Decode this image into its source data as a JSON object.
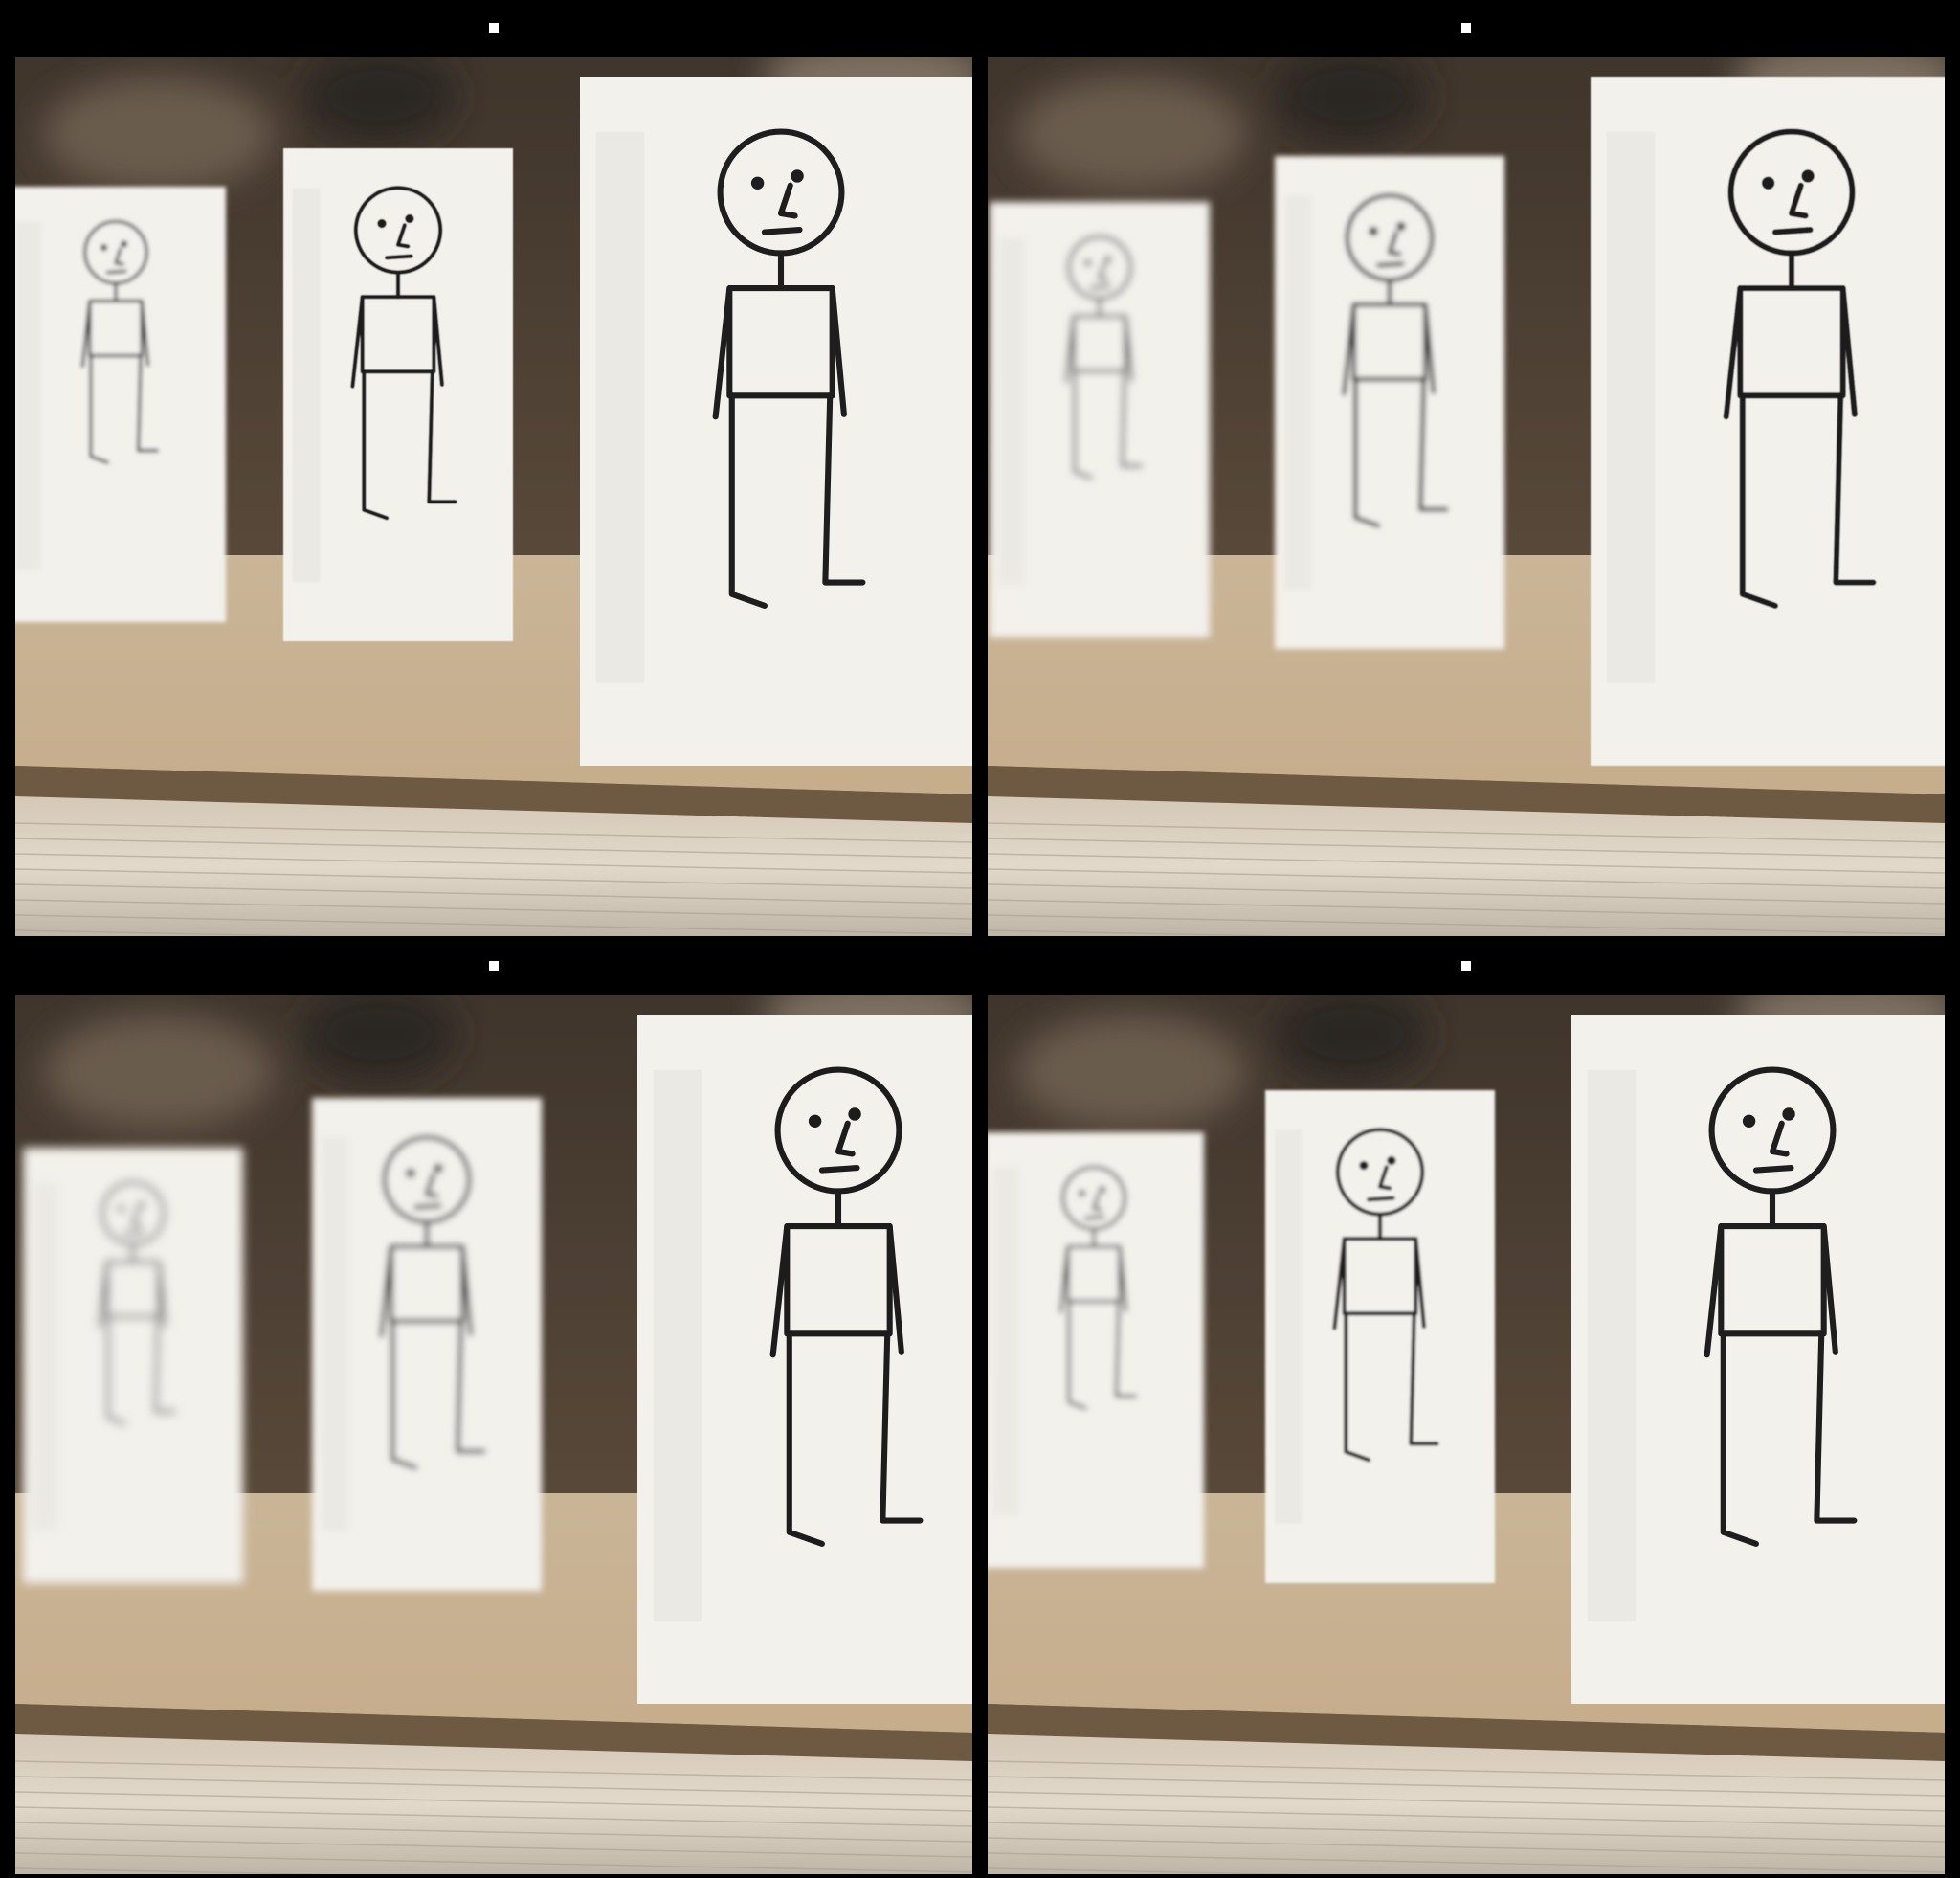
{
  "layout": {
    "rows": 2,
    "cols": 2
  },
  "colors": {
    "background": "#000000",
    "marker": "#ffffff",
    "wall": "#5d4c3c",
    "cardboard": "#c6ad8c",
    "cardboard_edge": "#6e5a42",
    "book_pages": "#e2d9cb",
    "card": "#f3f1ec",
    "ink": "#1e1e1e"
  },
  "panels": [
    {
      "id": "top-left",
      "scene_shift": 0,
      "blur": {
        "far": 2.2,
        "mid": 0.6,
        "near": 0.0
      }
    },
    {
      "id": "top-right",
      "scene_shift": 40,
      "blur": {
        "far": 4.0,
        "mid": 2.6,
        "near": 0.4
      }
    },
    {
      "id": "bottom-left",
      "scene_shift": 60,
      "blur": {
        "far": 5.0,
        "mid": 3.4,
        "near": 0.3
      }
    },
    {
      "id": "bottom-right",
      "scene_shift": 20,
      "blur": {
        "far": 3.2,
        "mid": 1.4,
        "near": 0.0
      }
    }
  ]
}
